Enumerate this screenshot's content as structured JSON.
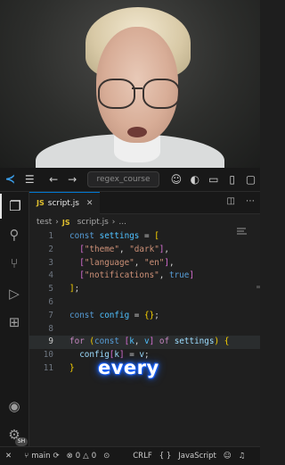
{
  "titlebar": {
    "title": "regex_course",
    "icons": [
      "vscode-logo",
      "menu-icon",
      "back-arrow-icon",
      "forward-arrow-icon",
      "copilot-icon",
      "layout-icon",
      "panel-icon",
      "sidebar-icon"
    ]
  },
  "activity_bar": {
    "items": [
      "explorer-icon",
      "search-icon",
      "source-control-icon",
      "run-debug-icon",
      "extensions-icon"
    ],
    "bottom": [
      "account-icon",
      "settings-icon"
    ],
    "badge": "SH"
  },
  "tab": {
    "icon_text": "JS",
    "label": "script.js"
  },
  "breadcrumb": {
    "folder": "test",
    "icon_text": "JS",
    "file": "script.js",
    "more": "..."
  },
  "code": {
    "line_numbers": [
      "1",
      "2",
      "3",
      "4",
      "5",
      "6",
      "7",
      "8",
      "9",
      "10",
      "11"
    ],
    "current_line": "9"
  },
  "caption": "every",
  "statusbar": {
    "branch": "main",
    "errors": "0",
    "warnings": "0",
    "line_ending": "CRLF",
    "brackets": "{ }",
    "language": "JavaScript"
  },
  "colors": {
    "accent": "#0078d4",
    "keyword": "#569cd6",
    "string": "#ce9178",
    "variable": "#9cdcfe",
    "flow": "#c586c0"
  }
}
